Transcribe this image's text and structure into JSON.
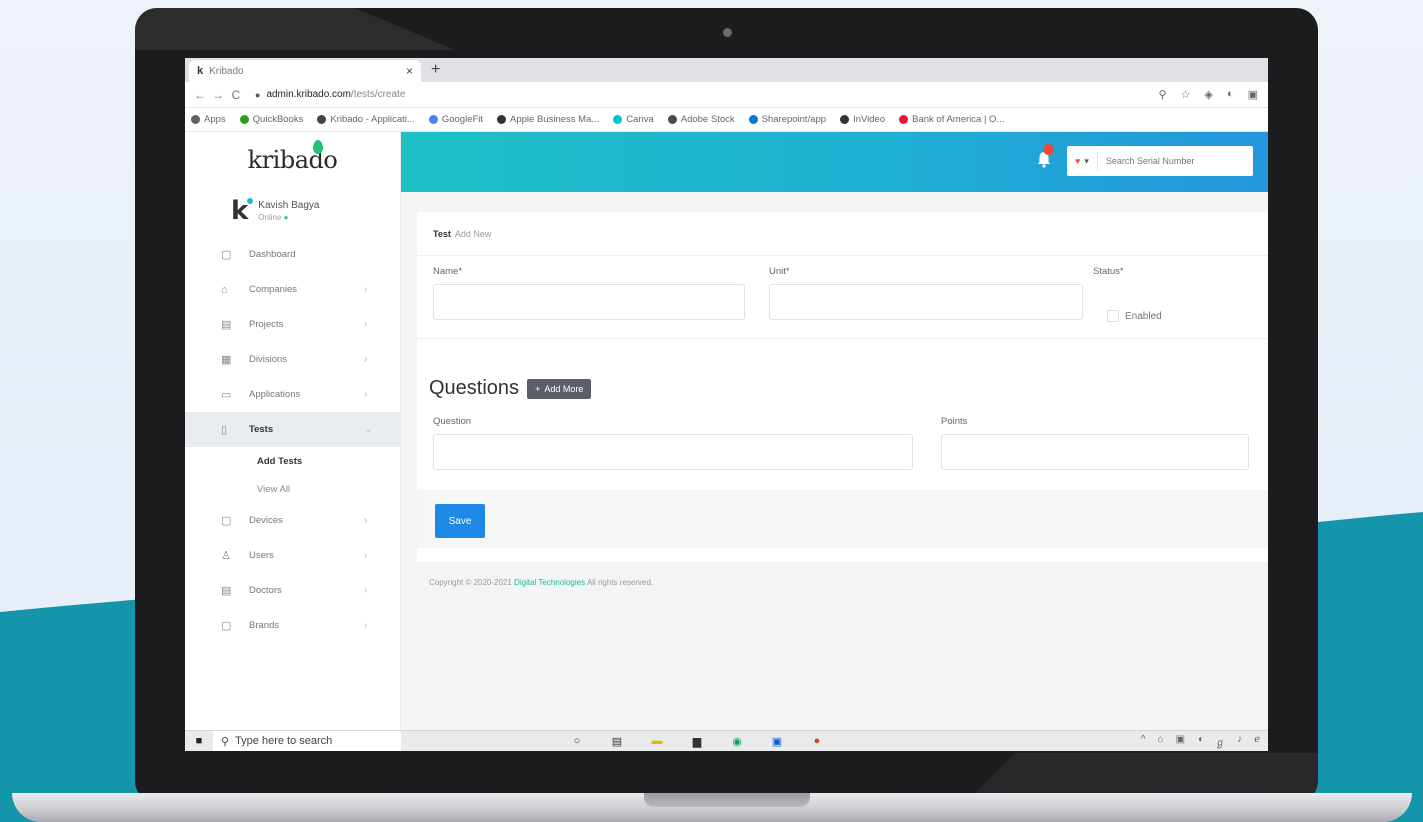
{
  "browser": {
    "tab_favicon": "k",
    "tab_title": "Kribado",
    "tab_close": "×",
    "new_tab": "+",
    "url_host": "admin.kribado.com",
    "url_path": "/tests/create",
    "nav": {
      "back": "←",
      "forward": "→",
      "reload": "C"
    },
    "bookmarks": [
      {
        "label": "Apps",
        "color": "#5f6368"
      },
      {
        "label": "QuickBooks",
        "color": "#2ca01c"
      },
      {
        "label": "Kribado - Applicati...",
        "color": "#444444"
      },
      {
        "label": "GoogleFit",
        "color": "#4285f4"
      },
      {
        "label": "Apple Business Ma...",
        "color": "#333333"
      },
      {
        "label": "Canva",
        "color": "#00c4cc"
      },
      {
        "label": "Adobe Stock",
        "color": "#4a4a4a"
      },
      {
        "label": "Sharepoint/app",
        "color": "#0078d4"
      },
      {
        "label": "InVideo",
        "color": "#333333"
      },
      {
        "label": "Bank of America | O...",
        "color": "#e31837"
      }
    ]
  },
  "sidebar": {
    "logo": "kribado",
    "user_avatar": "k",
    "user_name": "Kavish Bagya",
    "user_status": "Online",
    "items": [
      {
        "label": "Dashboard",
        "icon": "▢",
        "arrow": ""
      },
      {
        "label": "Companies",
        "icon": "⌂",
        "arrow": "›"
      },
      {
        "label": "Projects",
        "icon": "▤",
        "arrow": "›"
      },
      {
        "label": "Divisions",
        "icon": "▦",
        "arrow": "›"
      },
      {
        "label": "Applications",
        "icon": "▭",
        "arrow": "›"
      },
      {
        "label": "Tests",
        "icon": "▯",
        "arrow": "⌄"
      }
    ],
    "tests_submenu": [
      {
        "label": "Add Tests"
      },
      {
        "label": "View All"
      }
    ],
    "items_after": [
      {
        "label": "Devices",
        "icon": "▢",
        "arrow": "›"
      },
      {
        "label": "Users",
        "icon": "♙",
        "arrow": "›"
      },
      {
        "label": "Doctors",
        "icon": "▤",
        "arrow": "›"
      },
      {
        "label": "Brands",
        "icon": "▢",
        "arrow": "›"
      }
    ]
  },
  "topbar": {
    "search_dropdown": "▾",
    "search_placeholder": "Search Serial Number"
  },
  "form": {
    "header_bold": "Test",
    "header_muted": "Add New",
    "name_label": "Name*",
    "unit_label": "Unit*",
    "status_label": "Status*",
    "status_option": "Enabled",
    "questions_title": "Questions",
    "add_more": "Add More",
    "question_label": "Question",
    "points_label": "Points",
    "save": "Save"
  },
  "footer": {
    "prefix": "Copyright © 2020-2021",
    "brand": "Digital Technologies",
    "suffix": "All rights reserved."
  },
  "taskbar": {
    "search_placeholder": "Type here to search",
    "tray": [
      "^",
      "⌂",
      "▣",
      "◖",
      "ℊ",
      "♪",
      "ℯ"
    ]
  }
}
